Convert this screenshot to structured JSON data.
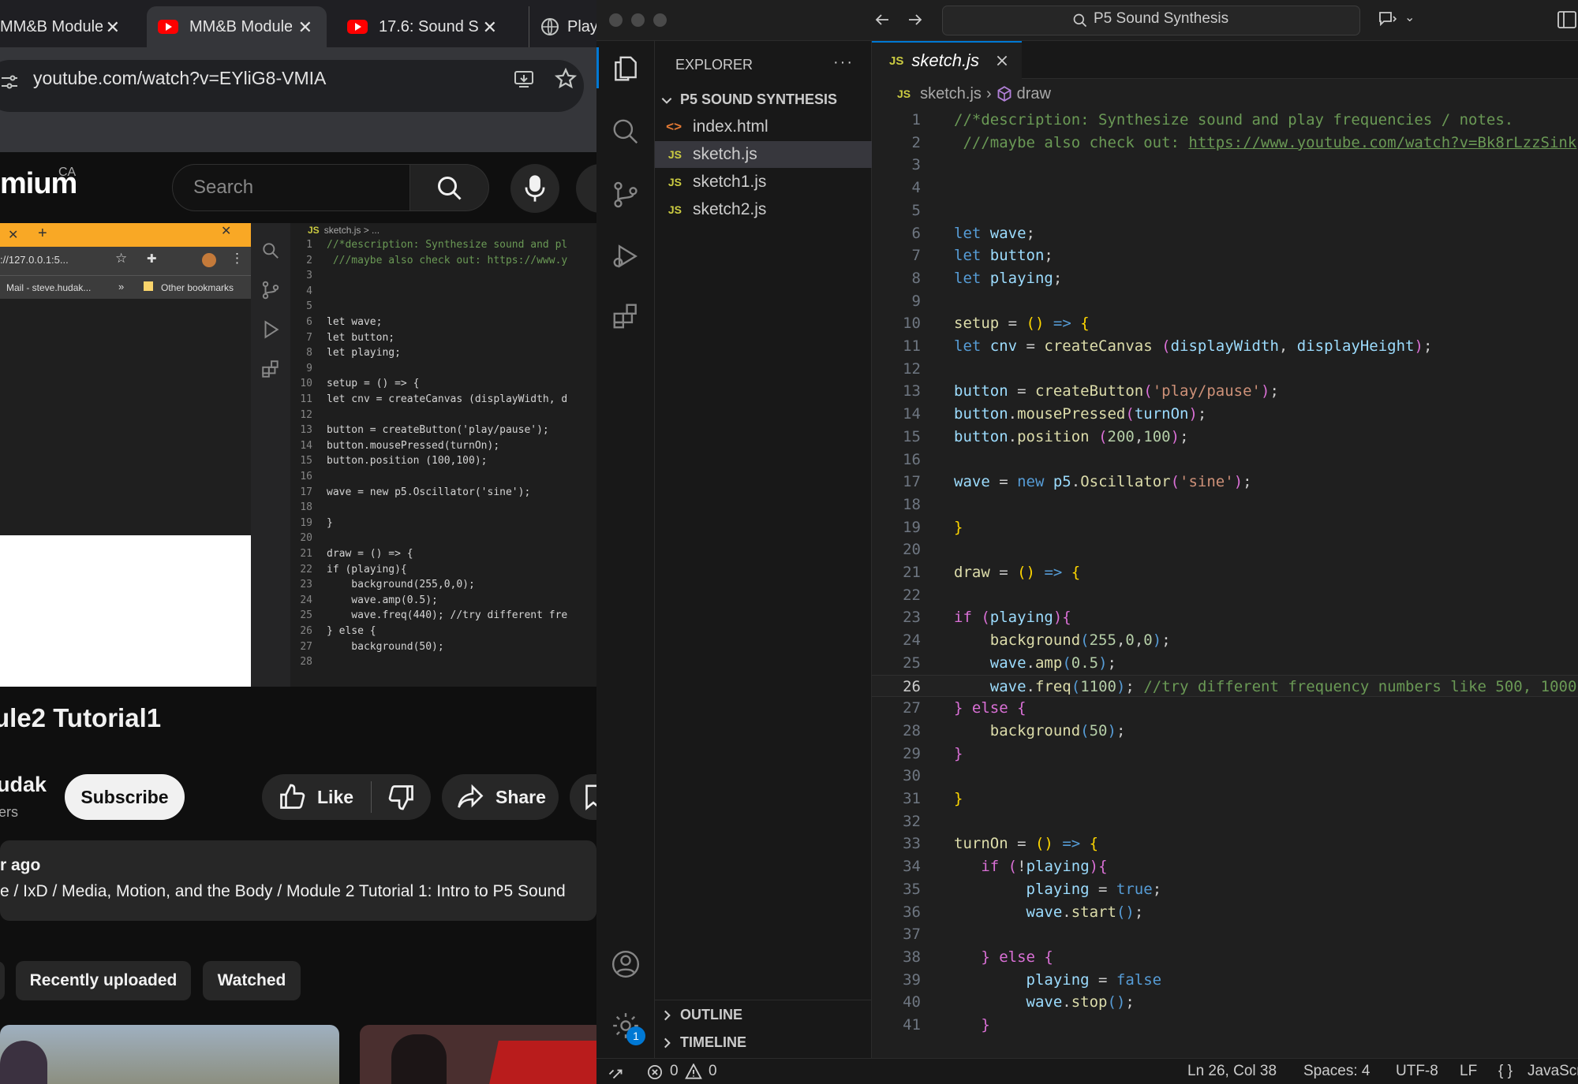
{
  "browser": {
    "tabs": [
      {
        "title": "MM&B Module",
        "icon": "youtube-icon",
        "active": false
      },
      {
        "title": "MM&B Module",
        "icon": "youtube-icon",
        "active": true
      },
      {
        "title": "17.6: Sound S",
        "icon": "youtube-icon",
        "active": false
      },
      {
        "title": "Play",
        "icon": "globe-icon",
        "active": false
      }
    ],
    "url": "youtube.com/watch?v=EYliG8-VMIA",
    "youtube": {
      "logo_fragment": "mium",
      "country": "CA",
      "search_placeholder": "Search",
      "video_title": "ule2 Tutorial1",
      "channel_fragment": "udak",
      "subscribers_fragment": "ers",
      "subscribe_label": "Subscribe",
      "like_label": "Like",
      "share_label": "Share",
      "upload_age": "r ago",
      "description_path": "e / IxD / Media, Motion, and the Body / Module 2 Tutorial 1: Intro to P5 Sound",
      "chips": [
        "Recently uploaded",
        "Watched"
      ]
    },
    "video_frame": {
      "omnibox": "://127.0.0.1:5...",
      "bookmarks": [
        "Mail - steve.hudak...",
        "»",
        "Other bookmarks"
      ],
      "editor_breadcrumb": "sketch.js > ...",
      "code_lines": [
        {
          "n": "1",
          "t": "//*description: Synthesize sound and pl"
        },
        {
          "n": "2",
          "t": " ///maybe also check out: https://www.y"
        },
        {
          "n": "3",
          "t": ""
        },
        {
          "n": "4",
          "t": ""
        },
        {
          "n": "5",
          "t": ""
        },
        {
          "n": "6",
          "t": "let wave;"
        },
        {
          "n": "7",
          "t": "let button;"
        },
        {
          "n": "8",
          "t": "let playing;"
        },
        {
          "n": "9",
          "t": ""
        },
        {
          "n": "10",
          "t": "setup = () => {"
        },
        {
          "n": "11",
          "t": "let cnv = createCanvas (displayWidth, d"
        },
        {
          "n": "12",
          "t": ""
        },
        {
          "n": "13",
          "t": "button = createButton('play/pause');"
        },
        {
          "n": "14",
          "t": "button.mousePressed(turnOn);"
        },
        {
          "n": "15",
          "t": "button.position (100,100);"
        },
        {
          "n": "16",
          "t": ""
        },
        {
          "n": "17",
          "t": "wave = new p5.Oscillator('sine');"
        },
        {
          "n": "18",
          "t": ""
        },
        {
          "n": "19",
          "t": "}"
        },
        {
          "n": "20",
          "t": ""
        },
        {
          "n": "21",
          "t": "draw = () => {"
        },
        {
          "n": "22",
          "t": "if (playing){"
        },
        {
          "n": "23",
          "t": "    background(255,0,0);"
        },
        {
          "n": "24",
          "t": "    wave.amp(0.5);"
        },
        {
          "n": "25",
          "t": "    wave.freq(440); //try different fre"
        },
        {
          "n": "26",
          "t": "} else {"
        },
        {
          "n": "27",
          "t": "    background(50);"
        },
        {
          "n": "28",
          "t": ""
        }
      ]
    }
  },
  "vscode": {
    "command_center": "P5 Sound Synthesis",
    "explorer_title": "EXPLORER",
    "explorer_more": "···",
    "project": "P5 SOUND SYNTHESIS",
    "files": [
      {
        "name": "index.html",
        "icon": "html-icon",
        "selected": false
      },
      {
        "name": "sketch.js",
        "icon": "js-icon",
        "selected": true
      },
      {
        "name": "sketch1.js",
        "icon": "js-icon",
        "selected": false
      },
      {
        "name": "sketch2.js",
        "icon": "js-icon",
        "selected": false
      }
    ],
    "outline": "OUTLINE",
    "timeline": "TIMELINE",
    "active_tab": "sketch.js",
    "breadcrumb": {
      "file": "sketch.js",
      "symbol": "draw"
    },
    "settings_badge": "1",
    "current_line": 26,
    "code": [
      {
        "n": "1",
        "h": [
          [
            "c",
            "//*description: Synthesize sound and play frequencies / notes."
          ]
        ]
      },
      {
        "n": "2",
        "h": [
          [
            "c",
            " ///maybe also check out: "
          ],
          [
            "u",
            "https://www.youtube.com/watch?v=Bk8rLzzSink"
          ]
        ]
      },
      {
        "n": "3",
        "h": []
      },
      {
        "n": "4",
        "h": []
      },
      {
        "n": "5",
        "h": []
      },
      {
        "n": "6",
        "h": [
          [
            "k",
            "let "
          ],
          [
            "v",
            "wave"
          ],
          [
            "t",
            ";"
          ]
        ]
      },
      {
        "n": "7",
        "h": [
          [
            "k",
            "let "
          ],
          [
            "v",
            "button"
          ],
          [
            "t",
            ";"
          ]
        ]
      },
      {
        "n": "8",
        "h": [
          [
            "k",
            "let "
          ],
          [
            "v",
            "playing"
          ],
          [
            "t",
            ";"
          ]
        ]
      },
      {
        "n": "9",
        "h": []
      },
      {
        "n": "10",
        "h": [
          [
            "f",
            "setup"
          ],
          [
            "t",
            " = "
          ],
          [
            "y",
            "()"
          ],
          [
            "t",
            " "
          ],
          [
            "k",
            "=>"
          ],
          [
            "t",
            " "
          ],
          [
            "y",
            "{"
          ]
        ]
      },
      {
        "n": "11",
        "h": [
          [
            "k",
            "let "
          ],
          [
            "v",
            "cnv"
          ],
          [
            "t",
            " = "
          ],
          [
            "f",
            "createCanvas"
          ],
          [
            "t",
            " "
          ],
          [
            "p",
            "("
          ],
          [
            "v",
            "displayWidth"
          ],
          [
            "t",
            ", "
          ],
          [
            "v",
            "displayHeight"
          ],
          [
            "p",
            ")"
          ],
          [
            "t",
            ";"
          ]
        ]
      },
      {
        "n": "12",
        "h": []
      },
      {
        "n": "13",
        "h": [
          [
            "v",
            "button"
          ],
          [
            "t",
            " = "
          ],
          [
            "f",
            "createButton"
          ],
          [
            "p",
            "("
          ],
          [
            "s",
            "'play/pause'"
          ],
          [
            "p",
            ")"
          ],
          [
            "t",
            ";"
          ]
        ]
      },
      {
        "n": "14",
        "h": [
          [
            "v",
            "button"
          ],
          [
            "t",
            "."
          ],
          [
            "f",
            "mousePressed"
          ],
          [
            "p",
            "("
          ],
          [
            "v",
            "turnOn"
          ],
          [
            "p",
            ")"
          ],
          [
            "t",
            ";"
          ]
        ]
      },
      {
        "n": "15",
        "h": [
          [
            "v",
            "button"
          ],
          [
            "t",
            "."
          ],
          [
            "f",
            "position"
          ],
          [
            "t",
            " "
          ],
          [
            "p",
            "("
          ],
          [
            "nm",
            "200"
          ],
          [
            "t",
            ","
          ],
          [
            "nm",
            "100"
          ],
          [
            "p",
            ")"
          ],
          [
            "t",
            ";"
          ]
        ]
      },
      {
        "n": "16",
        "h": []
      },
      {
        "n": "17",
        "h": [
          [
            "v",
            "wave"
          ],
          [
            "t",
            " = "
          ],
          [
            "k",
            "new "
          ],
          [
            "v",
            "p5"
          ],
          [
            "t",
            "."
          ],
          [
            "f",
            "Oscillator"
          ],
          [
            "p",
            "("
          ],
          [
            "s",
            "'sine'"
          ],
          [
            "p",
            ")"
          ],
          [
            "t",
            ";"
          ]
        ]
      },
      {
        "n": "18",
        "h": []
      },
      {
        "n": "19",
        "h": [
          [
            "y",
            "}"
          ]
        ]
      },
      {
        "n": "20",
        "h": []
      },
      {
        "n": "21",
        "h": [
          [
            "f",
            "draw"
          ],
          [
            "t",
            " = "
          ],
          [
            "y",
            "()"
          ],
          [
            "t",
            " "
          ],
          [
            "k",
            "=>"
          ],
          [
            "t",
            " "
          ],
          [
            "y",
            "{"
          ]
        ]
      },
      {
        "n": "22",
        "h": []
      },
      {
        "n": "23",
        "h": [
          [
            "p",
            "if "
          ],
          [
            "p",
            "("
          ],
          [
            "v",
            "playing"
          ],
          [
            "p",
            "){"
          ]
        ]
      },
      {
        "n": "24",
        "h": [
          [
            "t",
            "    "
          ],
          [
            "f",
            "background"
          ],
          [
            "k",
            "("
          ],
          [
            "nm",
            "255"
          ],
          [
            "t",
            ","
          ],
          [
            "nm",
            "0"
          ],
          [
            "t",
            ","
          ],
          [
            "nm",
            "0"
          ],
          [
            "k",
            ")"
          ],
          [
            "t",
            ";"
          ]
        ]
      },
      {
        "n": "25",
        "h": [
          [
            "t",
            "    "
          ],
          [
            "v",
            "wave"
          ],
          [
            "t",
            "."
          ],
          [
            "f",
            "amp"
          ],
          [
            "k",
            "("
          ],
          [
            "nm",
            "0.5"
          ],
          [
            "k",
            ")"
          ],
          [
            "t",
            ";"
          ]
        ]
      },
      {
        "n": "26",
        "h": [
          [
            "t",
            "    "
          ],
          [
            "v",
            "wave"
          ],
          [
            "t",
            "."
          ],
          [
            "f",
            "freq"
          ],
          [
            "k",
            "("
          ],
          [
            "nm",
            "1100"
          ],
          [
            "k",
            ")"
          ],
          [
            "t",
            "; "
          ],
          [
            "c",
            "//try different frequency numbers like 500, 1000"
          ]
        ]
      },
      {
        "n": "27",
        "h": [
          [
            "p",
            "} "
          ],
          [
            "p",
            "else "
          ],
          [
            "p",
            "{"
          ]
        ]
      },
      {
        "n": "28",
        "h": [
          [
            "t",
            "    "
          ],
          [
            "f",
            "background"
          ],
          [
            "k",
            "("
          ],
          [
            "nm",
            "50"
          ],
          [
            "k",
            ")"
          ],
          [
            "t",
            ";"
          ]
        ]
      },
      {
        "n": "29",
        "h": [
          [
            "p",
            "}"
          ]
        ]
      },
      {
        "n": "30",
        "h": []
      },
      {
        "n": "31",
        "h": [
          [
            "y",
            "}"
          ]
        ]
      },
      {
        "n": "32",
        "h": []
      },
      {
        "n": "33",
        "h": [
          [
            "f",
            "turnOn"
          ],
          [
            "t",
            " = "
          ],
          [
            "y",
            "()"
          ],
          [
            "t",
            " "
          ],
          [
            "k",
            "=>"
          ],
          [
            "t",
            " "
          ],
          [
            "y",
            "{"
          ]
        ]
      },
      {
        "n": "34",
        "h": [
          [
            "t",
            "   "
          ],
          [
            "p",
            "if "
          ],
          [
            "p",
            "("
          ],
          [
            "t",
            "!"
          ],
          [
            "v",
            "playing"
          ],
          [
            "p",
            "){"
          ]
        ]
      },
      {
        "n": "35",
        "h": [
          [
            "t",
            "        "
          ],
          [
            "v",
            "playing"
          ],
          [
            "t",
            " = "
          ],
          [
            "k",
            "true"
          ],
          [
            "t",
            ";"
          ]
        ]
      },
      {
        "n": "36",
        "h": [
          [
            "t",
            "        "
          ],
          [
            "v",
            "wave"
          ],
          [
            "t",
            "."
          ],
          [
            "f",
            "start"
          ],
          [
            "k",
            "()"
          ],
          [
            "t",
            ";"
          ]
        ]
      },
      {
        "n": "37",
        "h": []
      },
      {
        "n": "38",
        "h": [
          [
            "t",
            "   "
          ],
          [
            "p",
            "} "
          ],
          [
            "p",
            "else "
          ],
          [
            "p",
            "{"
          ]
        ]
      },
      {
        "n": "39",
        "h": [
          [
            "t",
            "        "
          ],
          [
            "v",
            "playing"
          ],
          [
            "t",
            " = "
          ],
          [
            "k",
            "false"
          ]
        ]
      },
      {
        "n": "40",
        "h": [
          [
            "t",
            "        "
          ],
          [
            "v",
            "wave"
          ],
          [
            "t",
            "."
          ],
          [
            "f",
            "stop"
          ],
          [
            "k",
            "()"
          ],
          [
            "t",
            ";"
          ]
        ]
      },
      {
        "n": "41",
        "h": [
          [
            "t",
            "   "
          ],
          [
            "p",
            "}"
          ]
        ]
      }
    ],
    "status": {
      "errors": "0",
      "warnings": "0",
      "position": "Ln 26, Col 38",
      "spaces": "Spaces: 4",
      "encoding": "UTF-8",
      "eol": "LF",
      "language": "JavaScript"
    }
  },
  "colors": {
    "youtube_red": "#ff0000",
    "vscode_accent": "#0078d4",
    "js_badge": "#cbcb41",
    "video_tabbar": "#f9a825"
  }
}
